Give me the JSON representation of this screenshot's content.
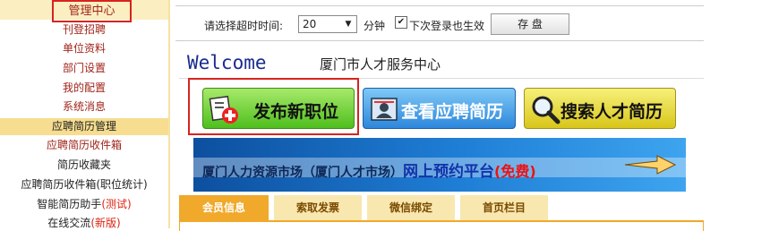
{
  "sidebar": {
    "active_item": "管理中心",
    "items_top": [
      "刊登招聘",
      "单位资料",
      "部门设置",
      "我的配置",
      "系统消息"
    ],
    "section_title": "应聘简历管理",
    "items_bottom": [
      "应聘简历收件箱",
      "简历收藏夹",
      "应聘简历收件箱(职位统计)"
    ],
    "smart_helper": {
      "label": "智能简历助手",
      "tag": "(测试)"
    },
    "online_chat": {
      "label": "在线交流",
      "tag": "(新版)"
    }
  },
  "settings": {
    "timeout_label": "请选择超时时间:",
    "timeout_value": "20",
    "unit": "分钟",
    "remember_checked": true,
    "remember_label": "下次登录也生效",
    "save_label": "存 盘"
  },
  "welcome": {
    "greeting": "Welcome",
    "org_name": "厦门市人才服务中心"
  },
  "actions": {
    "publish_label": "发布新职位",
    "view_label": "查看应聘简历",
    "search_label": "搜索人才简历"
  },
  "banner": {
    "text_main": "厦门人力资源市场（厦门人才市场）",
    "text_highlight": "网上预约平台",
    "text_free": "(免费)"
  },
  "tabs": [
    "会员信息",
    "索取发票",
    "微信绑定",
    "首页栏目"
  ],
  "colors": {
    "highlight_red": "#d8231e",
    "tab_active": "#f0a92a",
    "section_bg": "#f6dd8f"
  }
}
